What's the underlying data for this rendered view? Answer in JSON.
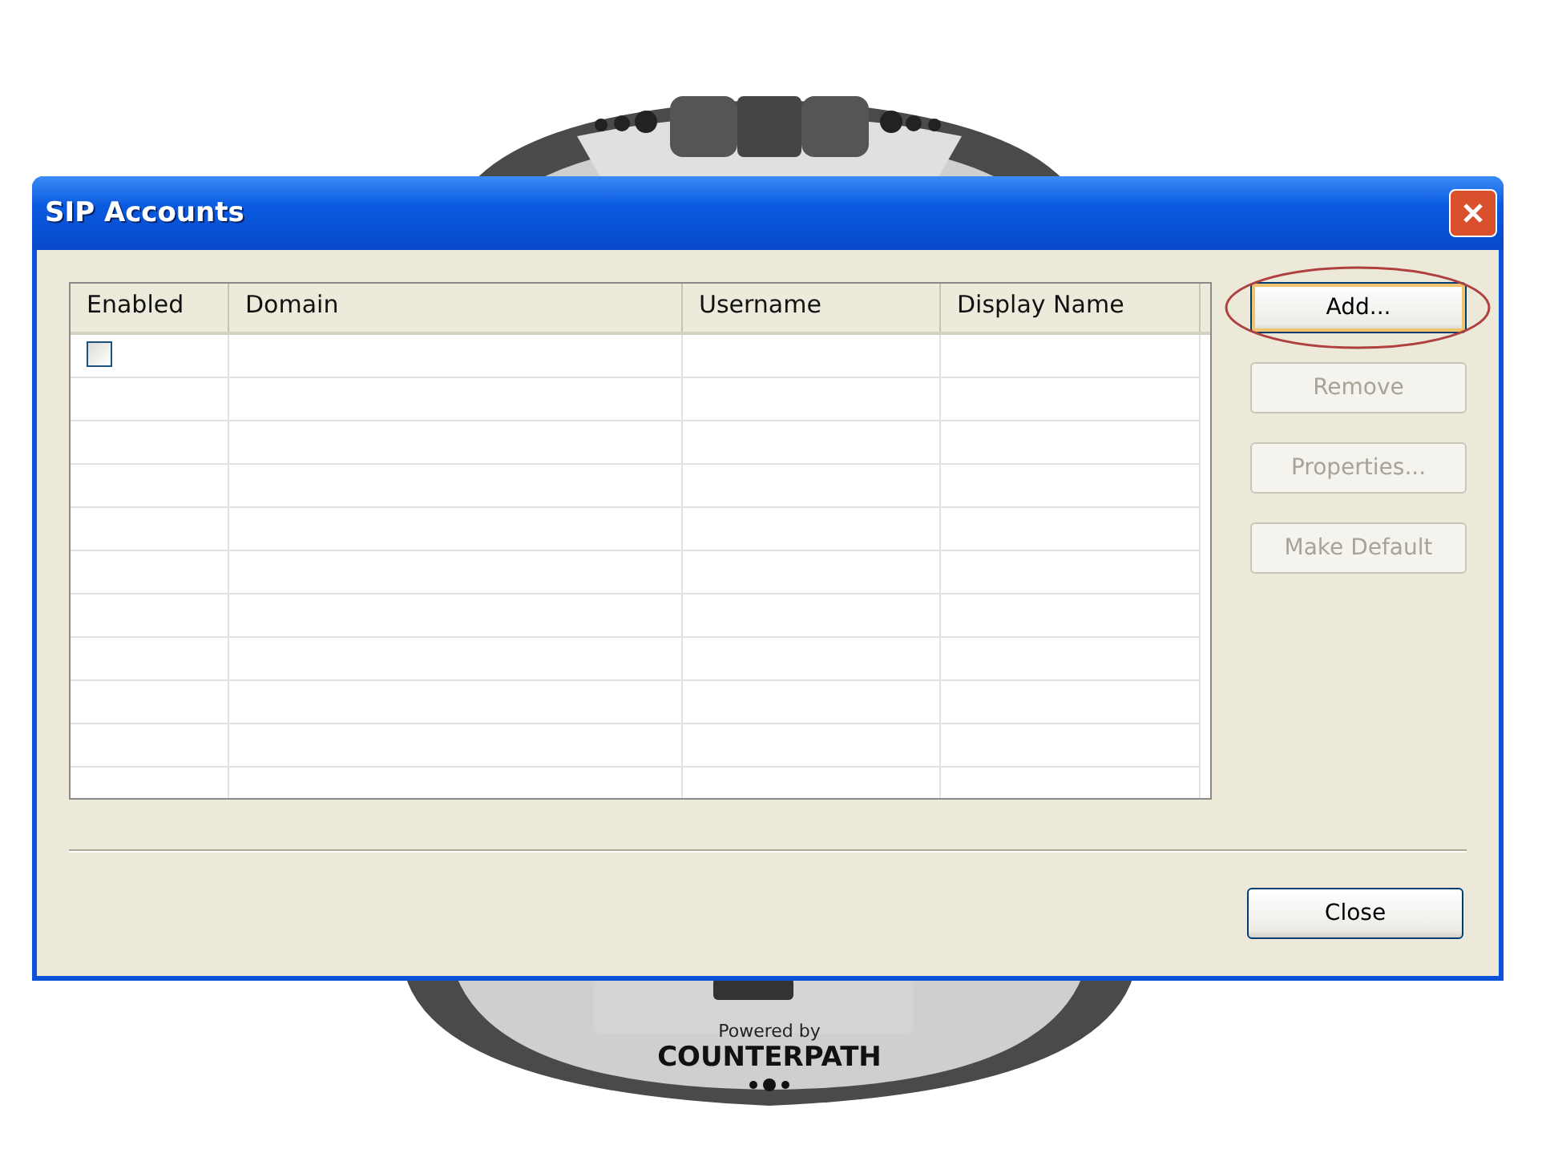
{
  "phone": {
    "brand_caption": "Powered by",
    "brand": "COUNTERPATH"
  },
  "window": {
    "title": "SIP Accounts"
  },
  "table": {
    "columns": [
      "Enabled",
      "Domain",
      "Username",
      "Display Name"
    ],
    "rows": [
      {
        "enabled": false
      }
    ]
  },
  "buttons": [
    {
      "label": "Add...",
      "disabled": false,
      "highlighted": true
    },
    {
      "label": "Remove",
      "disabled": true,
      "highlighted": false
    },
    {
      "label": "Properties...",
      "disabled": true,
      "highlighted": false
    },
    {
      "label": "Make Default",
      "disabled": true,
      "highlighted": false
    }
  ],
  "footer_buttons": [
    {
      "label": "Close",
      "disabled": false
    }
  ]
}
